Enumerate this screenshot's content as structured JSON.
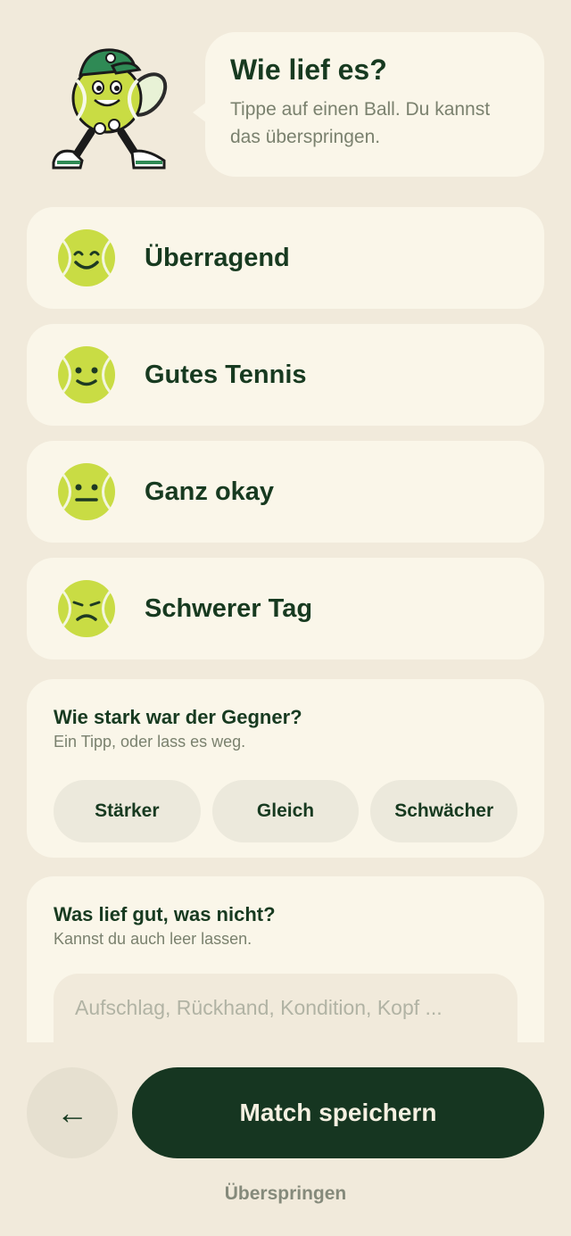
{
  "header": {
    "title": "Wie lief es?",
    "subtitle": "Tippe auf einen Ball. Du kannst das überspringen."
  },
  "ratings": [
    {
      "label": "Überragend",
      "icon": "ball-big-smile-icon"
    },
    {
      "label": "Gutes Tennis",
      "icon": "ball-smile-icon"
    },
    {
      "label": "Ganz okay",
      "icon": "ball-neutral-icon"
    },
    {
      "label": "Schwerer Tag",
      "icon": "ball-sad-icon"
    }
  ],
  "opponent": {
    "title": "Wie stark war der Gegner?",
    "subtitle": "Ein Tipp, oder lass es weg.",
    "options": [
      "Stärker",
      "Gleich",
      "Schwächer"
    ]
  },
  "notes": {
    "title": "Was lief gut, was nicht?",
    "subtitle": "Kannst du auch leer lassen.",
    "placeholder": "Aufschlag, Rückhand, Kondition, Kopf ..."
  },
  "footer": {
    "back_icon": "←",
    "save_label": "Match speichern",
    "skip_label": "Überspringen"
  },
  "colors": {
    "background": "#f1eadb",
    "card": "#faf6e9",
    "primary": "#163621",
    "ball": "#c9dc44"
  }
}
